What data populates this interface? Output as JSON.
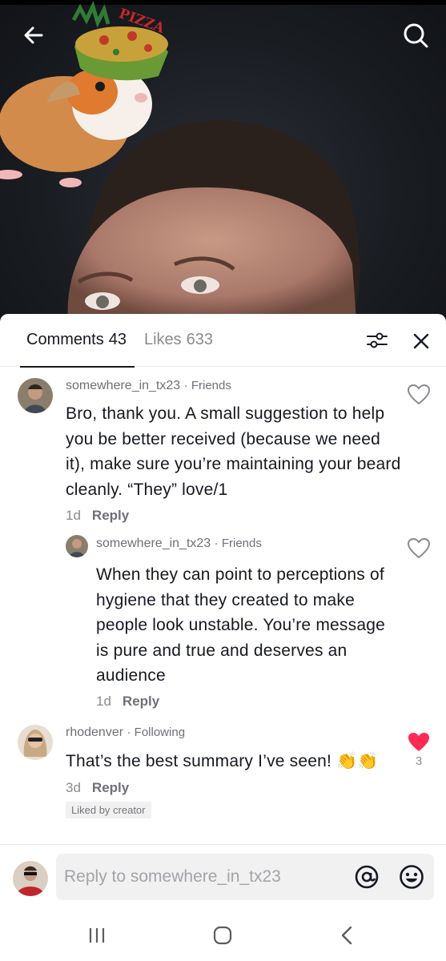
{
  "video": {
    "sticker_text": "PIZZA"
  },
  "tabs": [
    {
      "label": "Comments",
      "count": "43",
      "active": true
    },
    {
      "label": "Likes",
      "count": "633",
      "active": false
    }
  ],
  "comments": [
    {
      "username": "somewhere_in_tx23",
      "relation": "Friends",
      "text": "Bro, thank you. A small suggestion to help you be better received (because we need it), make sure you’re maintaining your beard cleanly. “They” love/1",
      "time": "1d",
      "reply_label": "Reply",
      "liked": false
    },
    {
      "username": "somewhere_in_tx23",
      "relation": "Friends",
      "text": "When they can point to perceptions of hygiene that they created to make people look unstable. You’re message is pure and true and deserves an audience",
      "time": "1d",
      "reply_label": "Reply",
      "liked": false,
      "is_reply": true
    },
    {
      "username": "rhodenver",
      "relation": "Following",
      "text": "That’s the best summary I’ve seen! 👏👏",
      "time": "3d",
      "reply_label": "Reply",
      "liked": true,
      "like_count": "3",
      "badge": "Liked by creator"
    }
  ],
  "reply_bar": {
    "placeholder": "Reply to somewhere_in_tx23",
    "at_icon": "at-icon",
    "emoji_icon": "emoji-icon"
  },
  "colors": {
    "primary_text": "#161823",
    "secondary_text": "#8a8b91",
    "like_red": "#fe2c55",
    "badge_bg": "#f1f1f2"
  }
}
